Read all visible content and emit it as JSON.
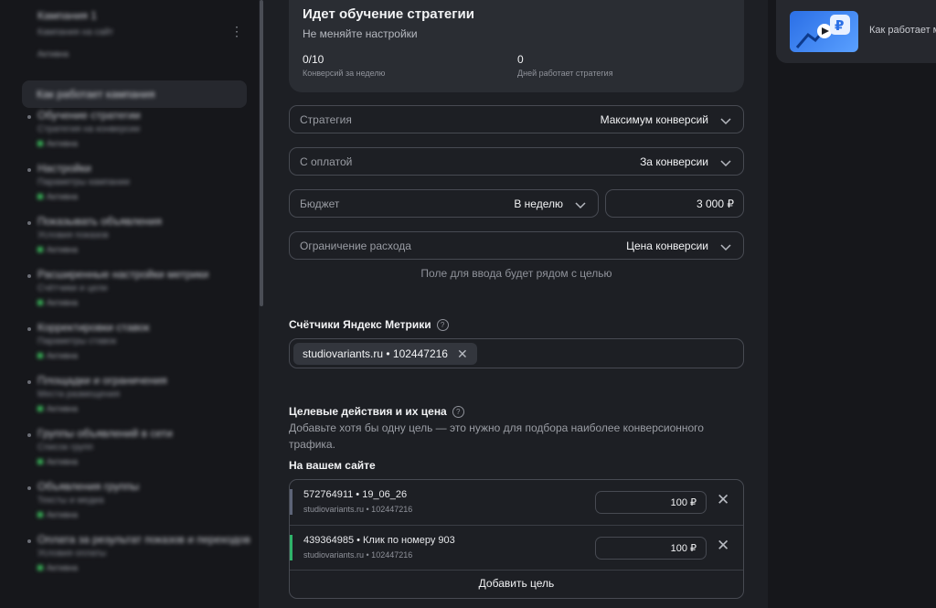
{
  "sidebar": {
    "top": {
      "title": "Кампания 1",
      "subtitle": "Кампания на сайт",
      "badge": "Активна"
    },
    "selected": "Как работает кампания",
    "items": [
      {
        "title": "Обучение стратегии",
        "sub": "Стратегия на конверсии",
        "badge": "Активна"
      },
      {
        "title": "Настройки",
        "sub": "Параметры кампании",
        "badge": "Активна"
      },
      {
        "title": "Показывать объявления",
        "sub": "Условия показов",
        "badge": "Активна"
      },
      {
        "title": "Расширенные настройки метрики",
        "sub": "Счётчики и цели",
        "badge": "Активна"
      },
      {
        "title": "Корректировки ставок",
        "sub": "Параметры ставок",
        "badge": "Активна"
      },
      {
        "title": "Площадки и ограничения",
        "sub": "Места размещения",
        "badge": "Активна"
      },
      {
        "title": "Группы объявлений в сети",
        "sub": "Список групп",
        "badge": "Активна"
      },
      {
        "title": "Объявления группы",
        "sub": "Тексты и медиа",
        "badge": "Активна"
      },
      {
        "title": "Оплата за результат показов и переходов",
        "sub": "Условия оплаты",
        "badge": "Активна"
      }
    ]
  },
  "status": {
    "title": "Идет обучение стратегии",
    "subtitle": "Не меняйте настройки",
    "conversions_value": "0/10",
    "conversions_label": "Конверсий за неделю",
    "days_value": "0",
    "days_label": "Дней работает стратегия"
  },
  "form": {
    "strategy_label": "Стратегия",
    "strategy_value": "Максимум конверсий",
    "payment_label": "С оплатой",
    "payment_value": "За конверсии",
    "budget_label": "Бюджет",
    "budget_period": "В неделю",
    "budget_amount": "3 000 ₽",
    "limit_label": "Ограничение расхода",
    "limit_value": "Цена конверсии",
    "hint": "Поле для ввода будет рядом с целью"
  },
  "counters": {
    "title": "Счётчики Яндекс Метрики",
    "chip": "studiovariants.ru • 102447216"
  },
  "goals": {
    "title": "Целевые действия и их цена",
    "description": "Добавьте хотя бы одну цель — это нужно для подбора наиболее конверсионного трафика.",
    "on_site": "На вашем сайте",
    "rows": [
      {
        "name": "572764911 • 19_06_26",
        "counter": "studiovariants.ru • 102447216",
        "price": "100 ₽",
        "bar_color": "#5d6478"
      },
      {
        "name": "439364985 • Клик по номеру 903",
        "counter": "studiovariants.ru • 102447216",
        "price": "100 ₽",
        "bar_color": "#2fb36a"
      }
    ],
    "add_label": "Добавить цель"
  },
  "video": {
    "label": "Как работает м"
  }
}
